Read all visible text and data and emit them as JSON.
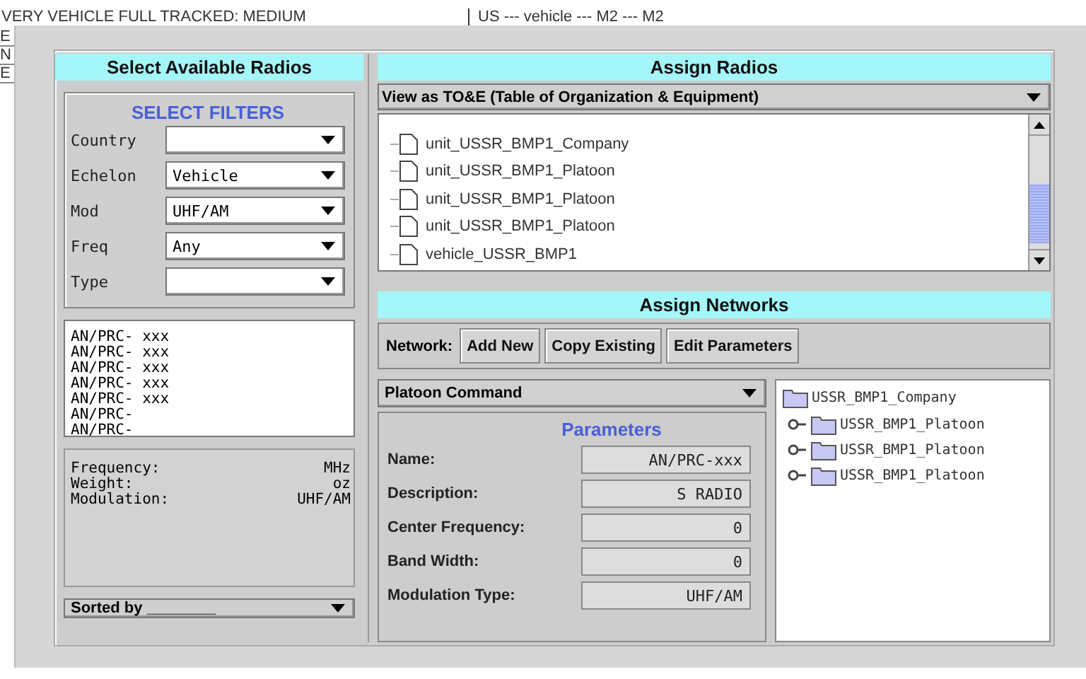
{
  "background_window": {
    "line_1": "VERY VEHICLE FULL TRACKED: MEDIUM",
    "line_2": "US --- vehicle --- M2 --- M2",
    "side_letters": [
      "E",
      "N",
      "E"
    ]
  },
  "select_radios": {
    "title": "Select Available Radios",
    "filters_title": "SELECT FILTERS",
    "filters": [
      {
        "label": "Country"
      },
      {
        "label": "Echelon",
        "value": "Vehicle"
      },
      {
        "label": "Mod",
        "value": "UHF/AM"
      },
      {
        "label": "Freq",
        "value": "Any"
      },
      {
        "label": "Type"
      }
    ],
    "radios": [
      "AN/PRC- xxx",
      "AN/PRC- xxx",
      "AN/PRC- xxx",
      "AN/PRC- xxx",
      "AN/PRC- xxx",
      "AN/PRC-",
      "AN/PRC-"
    ],
    "details": [
      {
        "label": "Frequency:",
        "value": "MHz"
      },
      {
        "label": "Weight:",
        "value": "oz"
      },
      {
        "label": "Modulation:",
        "value": "UHF/AM"
      }
    ],
    "sort": "Sorted by ________"
  },
  "assign_radios": {
    "title": "Assign Radios",
    "view": "View as TO&E (Table of Organization & Equipment)",
    "tree_items": [
      "unit_USSR_BMP1_Company",
      "unit_USSR_BMP1_Platoon",
      "unit_USSR_BMP1_Platoon",
      "unit_USSR_BMP1_Platoon",
      "vehicle_USSR_BMP1"
    ]
  },
  "assign_networks": {
    "title": "Assign Networks",
    "network_label": "Network:",
    "buttons": [
      "Add New",
      "Copy Existing",
      "Edit Parameters"
    ],
    "network": "Platoon Command",
    "parameters_title": "Parameters",
    "parameters": [
      {
        "label": "Name:",
        "value": "AN/PRC-xxx"
      },
      {
        "label": "Description:",
        "value": "S RADIO"
      },
      {
        "label": "Center Frequency:",
        "value": "0"
      },
      {
        "label": "Band Width:",
        "value": "0"
      },
      {
        "label": "Modulation Type:",
        "value": "UHF/AM"
      }
    ],
    "tree": [
      {
        "label": "USSR_BMP1_Company",
        "children": [
          {
            "label": "USSR_BMP1_Platoon"
          },
          {
            "label": "USSR_BMP1_Platoon"
          },
          {
            "label": "USSR_BMP1_Platoon"
          }
        ]
      }
    ]
  }
}
